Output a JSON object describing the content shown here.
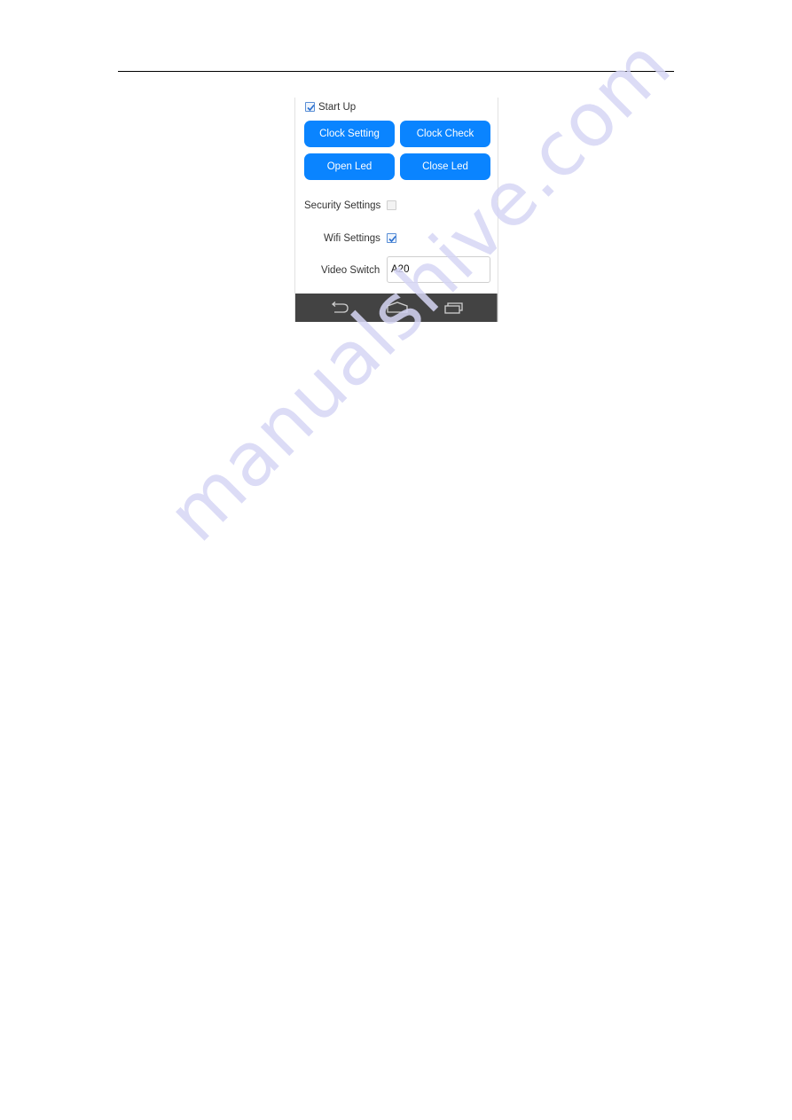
{
  "watermark": "manualshive.com",
  "app": {
    "start_up": {
      "label": "Start Up",
      "checked": true
    },
    "buttons": {
      "clock_setting": "Clock Setting",
      "clock_check": "Clock Check",
      "open_led": "Open Led",
      "close_led": "Close Led"
    },
    "security_settings": {
      "label": "Security Settings",
      "checked": false
    },
    "wifi_settings": {
      "label": "Wifi Settings",
      "checked": true
    },
    "video_switch": {
      "label": "Video Switch",
      "value": "A20"
    },
    "navbar": {
      "icons": [
        "back-icon",
        "home-icon",
        "recent-apps-icon"
      ]
    },
    "colors": {
      "accent": "#0a84ff",
      "navbar": "#434343"
    }
  }
}
